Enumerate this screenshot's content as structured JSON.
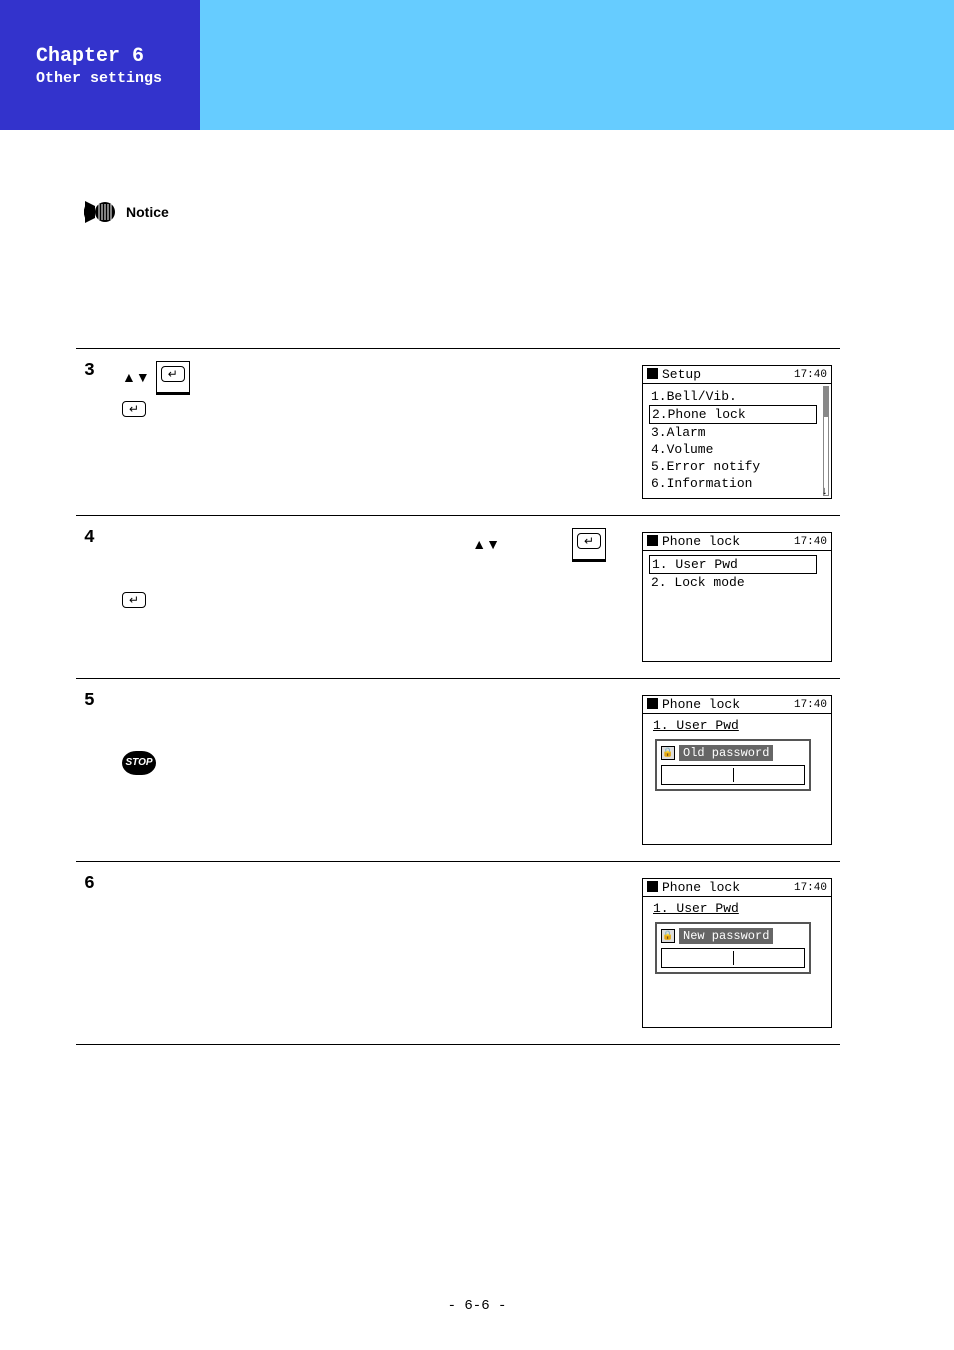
{
  "banner": {
    "chapter": "Chapter 6",
    "subtitle": "Other settings"
  },
  "notice_label": "Notice",
  "page_number": "- 6-6 -",
  "icons": {
    "updown": "▲▼",
    "enter": "↵",
    "stop": "STOP",
    "lock": "🔒",
    "scroll_down": "↓"
  },
  "steps": [
    {
      "num": "3",
      "screen": {
        "title": "Setup",
        "clock": "17:40",
        "list": [
          {
            "text": "1.Bell/Vib.",
            "selected": false
          },
          {
            "text": "2.Phone lock",
            "selected": true
          },
          {
            "text": "3.Alarm",
            "selected": false
          },
          {
            "text": "4.Volume",
            "selected": false
          },
          {
            "text": "5.Error notify",
            "selected": false
          },
          {
            "text": "6.Information",
            "selected": false
          }
        ],
        "scroll": true
      }
    },
    {
      "num": "4",
      "screen": {
        "title": "Phone lock",
        "clock": "17:40",
        "list": [
          {
            "text": "1. User Pwd",
            "selected": true
          },
          {
            "text": "2. Lock mode",
            "selected": false
          }
        ],
        "scroll": false
      }
    },
    {
      "num": "5",
      "screen": {
        "title": "Phone lock",
        "clock": "17:40",
        "subheader": "1. User Pwd",
        "pwd_label": "Old password"
      }
    },
    {
      "num": "6",
      "screen": {
        "title": "Phone lock",
        "clock": "17:40",
        "subheader": "1. User Pwd",
        "pwd_label": "New password"
      }
    }
  ]
}
